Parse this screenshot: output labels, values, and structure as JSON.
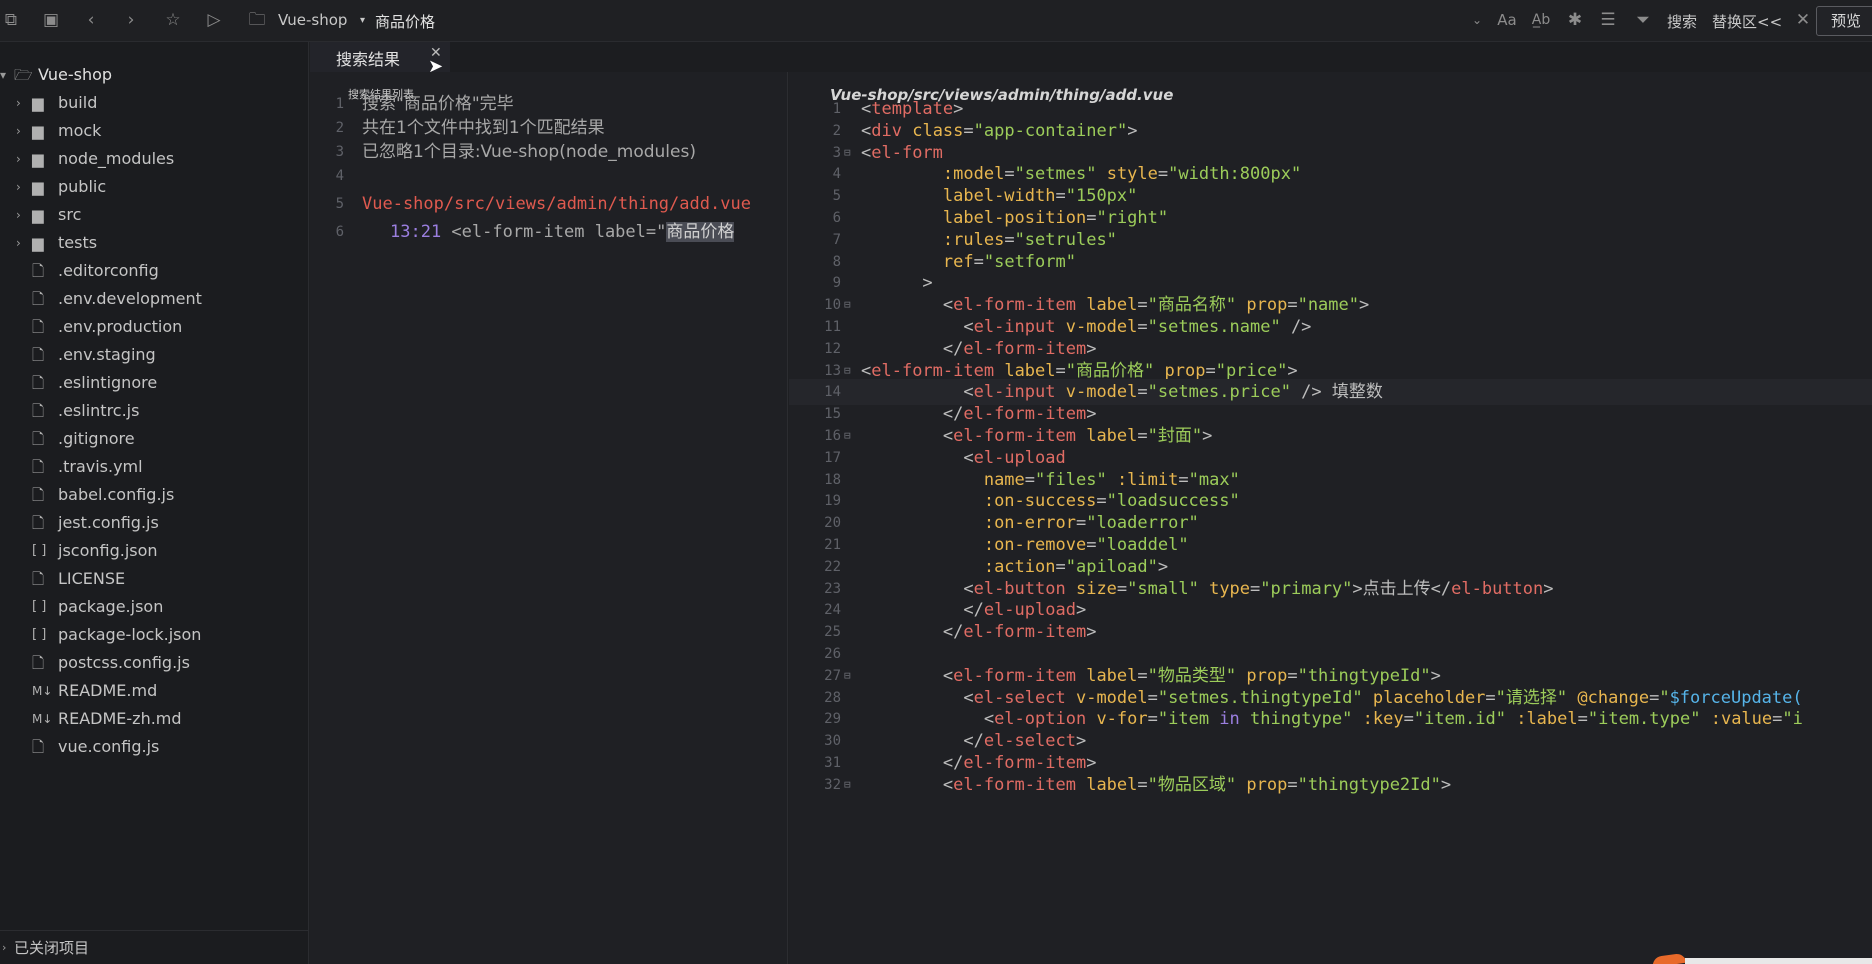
{
  "toolbar": {
    "project": "Vue-shop",
    "search_term": "商品价格",
    "search_label": "搜索",
    "replace_label": "替换区<<",
    "preview_label": "预览"
  },
  "sidebar": {
    "root": "Vue-shop",
    "items": [
      {
        "name": "build",
        "type": "folder"
      },
      {
        "name": "mock",
        "type": "folder"
      },
      {
        "name": "node_modules",
        "type": "folder"
      },
      {
        "name": "public",
        "type": "folder"
      },
      {
        "name": "src",
        "type": "folder"
      },
      {
        "name": "tests",
        "type": "folder"
      },
      {
        "name": ".editorconfig",
        "type": "file"
      },
      {
        "name": ".env.development",
        "type": "file"
      },
      {
        "name": ".env.production",
        "type": "file"
      },
      {
        "name": ".env.staging",
        "type": "file"
      },
      {
        "name": ".eslintignore",
        "type": "file"
      },
      {
        "name": ".eslintrc.js",
        "type": "js"
      },
      {
        "name": ".gitignore",
        "type": "file"
      },
      {
        "name": ".travis.yml",
        "type": "file"
      },
      {
        "name": "babel.config.js",
        "type": "js"
      },
      {
        "name": "jest.config.js",
        "type": "js"
      },
      {
        "name": "jsconfig.json",
        "type": "json"
      },
      {
        "name": "LICENSE",
        "type": "file"
      },
      {
        "name": "package.json",
        "type": "json"
      },
      {
        "name": "package-lock.json",
        "type": "json"
      },
      {
        "name": "postcss.config.js",
        "type": "js"
      },
      {
        "name": "README.md",
        "type": "md"
      },
      {
        "name": "README-zh.md",
        "type": "md"
      },
      {
        "name": "vue.config.js",
        "type": "js"
      }
    ],
    "closed_projects": "已关闭项目"
  },
  "search_panel": {
    "tab_label": "搜索结果",
    "list_title": "搜索结果列表",
    "lines": [
      {
        "n": "1",
        "text": "搜索\"商品价格\"完毕"
      },
      {
        "n": "2",
        "text": "共在1个文件中找到1个匹配结果"
      },
      {
        "n": "3",
        "text": "已忽略1个目录:Vue-shop(node_modules)"
      },
      {
        "n": "4",
        "text": ""
      },
      {
        "n": "5",
        "text": "Vue-shop/src/views/admin/thing/add.vue"
      },
      {
        "n": "6",
        "loc": "13:21",
        "pre": " <el-form-item label=\"",
        "match": "商品价格"
      }
    ]
  },
  "editor": {
    "file_path": "Vue-shop/src/views/admin/thing/add.vue",
    "current_line": 14,
    "lines": [
      {
        "n": "1",
        "fold": "",
        "code": [
          [
            "b",
            "<"
          ],
          [
            "t",
            "template"
          ],
          [
            "b",
            ">"
          ]
        ]
      },
      {
        "n": "2",
        "fold": "",
        "code": [
          [
            "b",
            "<"
          ],
          [
            "t",
            "div"
          ],
          [
            "b",
            " "
          ],
          [
            "a",
            "class"
          ],
          [
            "b",
            "="
          ],
          [
            "s",
            "\"app-container\""
          ],
          [
            "b",
            ">"
          ]
        ]
      },
      {
        "n": "3",
        "fold": "⊟",
        "code": [
          [
            "b",
            "<"
          ],
          [
            "t",
            "el-form"
          ]
        ]
      },
      {
        "n": "4",
        "fold": "",
        "code": [
          [
            "b",
            "        "
          ],
          [
            "a",
            ":model"
          ],
          [
            "b",
            "="
          ],
          [
            "s",
            "\"setmes\""
          ],
          [
            "b",
            " "
          ],
          [
            "a",
            "style"
          ],
          [
            "b",
            "="
          ],
          [
            "s",
            "\"width:800px\""
          ]
        ]
      },
      {
        "n": "5",
        "fold": "",
        "code": [
          [
            "b",
            "        "
          ],
          [
            "a",
            "label-width"
          ],
          [
            "b",
            "="
          ],
          [
            "s",
            "\"150px\""
          ]
        ]
      },
      {
        "n": "6",
        "fold": "",
        "code": [
          [
            "b",
            "        "
          ],
          [
            "a",
            "label-position"
          ],
          [
            "b",
            "="
          ],
          [
            "s",
            "\"right\""
          ]
        ]
      },
      {
        "n": "7",
        "fold": "",
        "code": [
          [
            "b",
            "        "
          ],
          [
            "a",
            ":rules"
          ],
          [
            "b",
            "="
          ],
          [
            "s",
            "\"setrules\""
          ]
        ]
      },
      {
        "n": "8",
        "fold": "",
        "code": [
          [
            "b",
            "        "
          ],
          [
            "a",
            "ref"
          ],
          [
            "b",
            "="
          ],
          [
            "s",
            "\"setform\""
          ]
        ]
      },
      {
        "n": "9",
        "fold": "",
        "code": [
          [
            "b",
            "      >"
          ]
        ]
      },
      {
        "n": "10",
        "fold": "⊟",
        "code": [
          [
            "b",
            "        <"
          ],
          [
            "t",
            "el-form-item"
          ],
          [
            "b",
            " "
          ],
          [
            "a",
            "label"
          ],
          [
            "b",
            "="
          ],
          [
            "s",
            "\"商品名称\""
          ],
          [
            "b",
            " "
          ],
          [
            "a",
            "prop"
          ],
          [
            "b",
            "="
          ],
          [
            "s",
            "\"name\""
          ],
          [
            "b",
            ">"
          ]
        ]
      },
      {
        "n": "11",
        "fold": "",
        "code": [
          [
            "b",
            "          <"
          ],
          [
            "t",
            "el-input"
          ],
          [
            "b",
            " "
          ],
          [
            "a",
            "v-model"
          ],
          [
            "b",
            "="
          ],
          [
            "s",
            "\"setmes.name\""
          ],
          [
            "b",
            " />"
          ]
        ]
      },
      {
        "n": "12",
        "fold": "",
        "code": [
          [
            "b",
            "        </"
          ],
          [
            "t",
            "el-form-item"
          ],
          [
            "b",
            ">"
          ]
        ]
      },
      {
        "n": "13",
        "fold": "⊟",
        "code": [
          [
            "b",
            "<"
          ],
          [
            "t",
            "el-form-item"
          ],
          [
            "b",
            " "
          ],
          [
            "a",
            "label"
          ],
          [
            "b",
            "="
          ],
          [
            "s",
            "\"商品价格\""
          ],
          [
            "b",
            " "
          ],
          [
            "a",
            "prop"
          ],
          [
            "b",
            "="
          ],
          [
            "s",
            "\"price\""
          ],
          [
            "b",
            ">"
          ]
        ]
      },
      {
        "n": "14",
        "fold": "",
        "code": [
          [
            "b",
            "          <"
          ],
          [
            "t",
            "el-input"
          ],
          [
            "b",
            " "
          ],
          [
            "a",
            "v-model"
          ],
          [
            "b",
            "="
          ],
          [
            "s",
            "\"setmes.price\""
          ],
          [
            "b",
            " /> 填整数"
          ]
        ]
      },
      {
        "n": "15",
        "fold": "",
        "code": [
          [
            "b",
            "        </"
          ],
          [
            "t",
            "el-form-item"
          ],
          [
            "b",
            ">"
          ]
        ]
      },
      {
        "n": "16",
        "fold": "⊟",
        "code": [
          [
            "b",
            "        <"
          ],
          [
            "t",
            "el-form-item"
          ],
          [
            "b",
            " "
          ],
          [
            "a",
            "label"
          ],
          [
            "b",
            "="
          ],
          [
            "s",
            "\"封面\""
          ],
          [
            "b",
            ">"
          ]
        ]
      },
      {
        "n": "17",
        "fold": "",
        "code": [
          [
            "b",
            "          <"
          ],
          [
            "t",
            "el-upload"
          ]
        ]
      },
      {
        "n": "18",
        "fold": "",
        "code": [
          [
            "b",
            "            "
          ],
          [
            "a",
            "name"
          ],
          [
            "b",
            "="
          ],
          [
            "s",
            "\"files\""
          ],
          [
            "b",
            " "
          ],
          [
            "a",
            ":limit"
          ],
          [
            "b",
            "="
          ],
          [
            "s",
            "\"max\""
          ]
        ]
      },
      {
        "n": "19",
        "fold": "",
        "code": [
          [
            "b",
            "            "
          ],
          [
            "a",
            ":on-success"
          ],
          [
            "b",
            "="
          ],
          [
            "s",
            "\"loadsuccess\""
          ]
        ]
      },
      {
        "n": "20",
        "fold": "",
        "code": [
          [
            "b",
            "            "
          ],
          [
            "a",
            ":on-error"
          ],
          [
            "b",
            "="
          ],
          [
            "s",
            "\"loaderror\""
          ]
        ]
      },
      {
        "n": "21",
        "fold": "",
        "code": [
          [
            "b",
            "            "
          ],
          [
            "a",
            ":on-remove"
          ],
          [
            "b",
            "="
          ],
          [
            "s",
            "\"loaddel\""
          ]
        ]
      },
      {
        "n": "22",
        "fold": "",
        "code": [
          [
            "b",
            "            "
          ],
          [
            "a",
            ":action"
          ],
          [
            "b",
            "="
          ],
          [
            "s",
            "\"apiload\""
          ],
          [
            "b",
            ">"
          ]
        ]
      },
      {
        "n": "23",
        "fold": "",
        "code": [
          [
            "b",
            "          <"
          ],
          [
            "t",
            "el-button"
          ],
          [
            "b",
            " "
          ],
          [
            "a",
            "size"
          ],
          [
            "b",
            "="
          ],
          [
            "s",
            "\"small\""
          ],
          [
            "b",
            " "
          ],
          [
            "a",
            "type"
          ],
          [
            "b",
            "="
          ],
          [
            "s",
            "\"primary\""
          ],
          [
            "b",
            ">点击上传</"
          ],
          [
            "t",
            "el-button"
          ],
          [
            "b",
            ">"
          ]
        ]
      },
      {
        "n": "24",
        "fold": "",
        "code": [
          [
            "b",
            "          </"
          ],
          [
            "t",
            "el-upload"
          ],
          [
            "b",
            ">"
          ]
        ]
      },
      {
        "n": "25",
        "fold": "",
        "code": [
          [
            "b",
            "        </"
          ],
          [
            "t",
            "el-form-item"
          ],
          [
            "b",
            ">"
          ]
        ]
      },
      {
        "n": "26",
        "fold": "",
        "code": [
          [
            "b",
            ""
          ]
        ]
      },
      {
        "n": "27",
        "fold": "⊟",
        "code": [
          [
            "b",
            "        <"
          ],
          [
            "t",
            "el-form-item"
          ],
          [
            "b",
            " "
          ],
          [
            "a",
            "label"
          ],
          [
            "b",
            "="
          ],
          [
            "s",
            "\"物品类型\""
          ],
          [
            "b",
            " "
          ],
          [
            "a",
            "prop"
          ],
          [
            "b",
            "="
          ],
          [
            "s",
            "\"thingtypeId\""
          ],
          [
            "b",
            ">"
          ]
        ]
      },
      {
        "n": "28",
        "fold": "",
        "code": [
          [
            "b",
            "          <"
          ],
          [
            "t",
            "el-select"
          ],
          [
            "b",
            " "
          ],
          [
            "a",
            "v-model"
          ],
          [
            "b",
            "="
          ],
          [
            "s",
            "\"setmes.thingtypeId\""
          ],
          [
            "b",
            " "
          ],
          [
            "a",
            "placeholder"
          ],
          [
            "b",
            "="
          ],
          [
            "s",
            "\"请选择\""
          ],
          [
            "b",
            " "
          ],
          [
            "a",
            "@change"
          ],
          [
            "b",
            "="
          ],
          [
            "s",
            "\""
          ],
          [
            "v",
            "$forceUpdate("
          ]
        ]
      },
      {
        "n": "29",
        "fold": "",
        "code": [
          [
            "b",
            "            <"
          ],
          [
            "t",
            "el-option"
          ],
          [
            "b",
            " "
          ],
          [
            "a",
            "v-for"
          ],
          [
            "b",
            "="
          ],
          [
            "s",
            "\"item "
          ],
          [
            "k",
            "in"
          ],
          [
            "s",
            " thingtype\""
          ],
          [
            "b",
            " "
          ],
          [
            "a",
            ":key"
          ],
          [
            "b",
            "="
          ],
          [
            "s",
            "\"item.id\""
          ],
          [
            "b",
            " "
          ],
          [
            "a",
            ":label"
          ],
          [
            "b",
            "="
          ],
          [
            "s",
            "\"item.type\""
          ],
          [
            "b",
            " "
          ],
          [
            "a",
            ":value"
          ],
          [
            "b",
            "="
          ],
          [
            "s",
            "\"i"
          ]
        ]
      },
      {
        "n": "30",
        "fold": "",
        "code": [
          [
            "b",
            "          </"
          ],
          [
            "t",
            "el-select"
          ],
          [
            "b",
            ">"
          ]
        ]
      },
      {
        "n": "31",
        "fold": "",
        "code": [
          [
            "b",
            "        </"
          ],
          [
            "t",
            "el-form-item"
          ],
          [
            "b",
            ">"
          ]
        ]
      },
      {
        "n": "32",
        "fold": "⊟",
        "code": [
          [
            "b",
            "        <"
          ],
          [
            "t",
            "el-form-item"
          ],
          [
            "b",
            " "
          ],
          [
            "a",
            "label"
          ],
          [
            "b",
            "="
          ],
          [
            "s",
            "\"物品区域\""
          ],
          [
            "b",
            " "
          ],
          [
            "a",
            "prop"
          ],
          [
            "b",
            "="
          ],
          [
            "s",
            "\"thingtype2Id\""
          ],
          [
            "b",
            ">"
          ]
        ]
      }
    ]
  }
}
